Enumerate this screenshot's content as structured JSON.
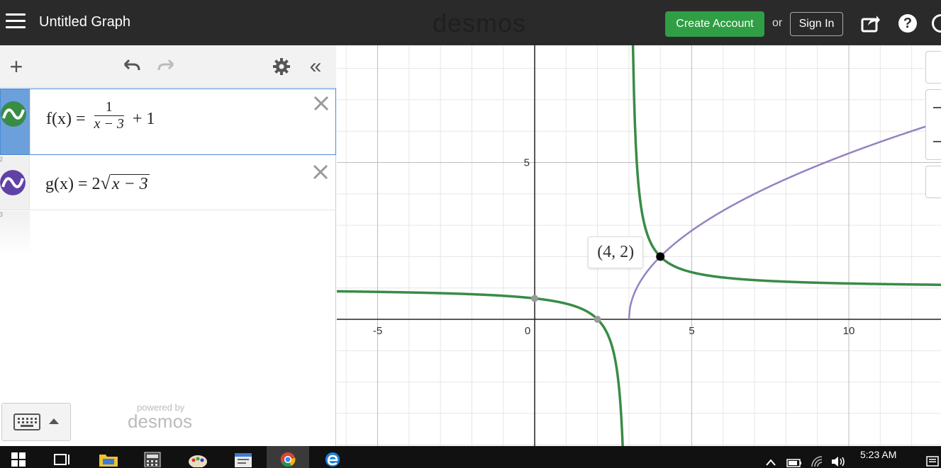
{
  "header": {
    "graph_title": "Untitled Graph",
    "brand": "desmos",
    "create_account_label": "Create Account",
    "or_text": "or",
    "sign_in_label": "Sign In",
    "help_glyph": "?"
  },
  "expressions": [
    {
      "index": "1",
      "name": "f",
      "latex_text": "f(x) = 1/(x − 3) + 1",
      "color": "#388c46",
      "lhs": "f(x) =",
      "numerator": "1",
      "denominator": "x − 3",
      "tail": "+ 1"
    },
    {
      "index": "2",
      "name": "g",
      "latex_text": "g(x) = 2√(x − 3)",
      "color": "#6042a6",
      "lhs": "g(x) =",
      "coef": "2",
      "radicand": "x − 3"
    },
    {
      "index": "3"
    }
  ],
  "panel": {
    "powered_by": "powered by",
    "powered_brand": "desmos"
  },
  "graph": {
    "x_range": [
      -6.4,
      12.8
    ],
    "y_range": [
      -8,
      17.4
    ],
    "major_step": 5,
    "minor_step": 1,
    "x_tick_labels": [
      "-5",
      "0",
      "5",
      "10"
    ],
    "y_tick_labels": [
      "5"
    ],
    "curve_colors": {
      "f": "#388c46",
      "g": "#9581c2"
    },
    "intersection_label": "(4, 2)",
    "intersection": [
      4,
      2
    ],
    "marked_points": [
      [
        0,
        0.6667
      ],
      [
        2,
        0
      ]
    ]
  },
  "taskbar": {
    "clock": "5:23 AM"
  }
}
